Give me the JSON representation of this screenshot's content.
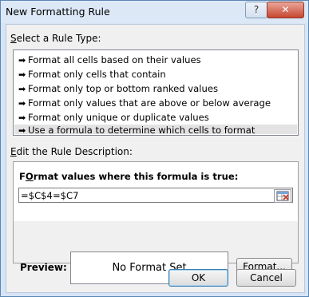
{
  "window": {
    "title": "New Formatting Rule",
    "help_glyph": "?",
    "close_glyph": "✕"
  },
  "select_rule": {
    "label_prefix": "S",
    "label_rest": "elect a Rule Type:",
    "items": [
      {
        "label": "Format all cells based on their values",
        "selected": false
      },
      {
        "label": "Format only cells that contain",
        "selected": false
      },
      {
        "label": "Format only top or bottom ranked values",
        "selected": false
      },
      {
        "label": "Format only values that are above or below average",
        "selected": false
      },
      {
        "label": "Format only unique or duplicate values",
        "selected": false
      },
      {
        "label": "Use a formula to determine which cells to format",
        "selected": true
      }
    ]
  },
  "edit_rule": {
    "label_prefix": "E",
    "label_rest": "dit the Rule Description:",
    "formula_label_prefix": "O",
    "formula_label_rest": "rmat values where this formula is true:",
    "formula_label_first": "F",
    "formula_value": "=$C$4=$C7",
    "preview_label": "Preview:",
    "preview_text": "No Format Set",
    "format_button_prefix": "F",
    "format_button_rest": "ormat..."
  },
  "buttons": {
    "ok": "OK",
    "cancel": "Cancel"
  }
}
